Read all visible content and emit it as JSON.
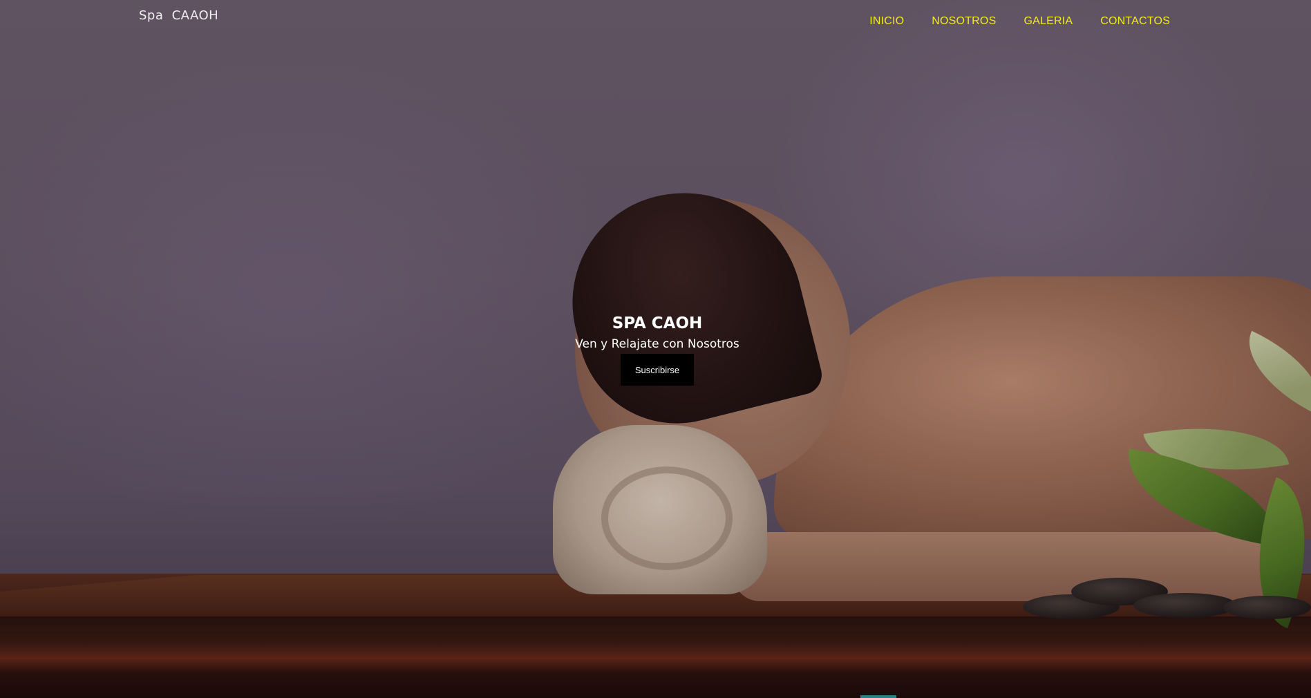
{
  "header": {
    "brand": "Spa  CAAOH",
    "nav": [
      {
        "label": "INICIO"
      },
      {
        "label": "NOSOTROS"
      },
      {
        "label": "GALERIA"
      },
      {
        "label": "CONTACTOS"
      }
    ]
  },
  "hero": {
    "title": "SPA CAOH",
    "subtitle": "Ven y Relajate con Nosotros",
    "button_label": "Suscribirse",
    "image_icon": "spa-massage-photo"
  },
  "colors": {
    "nav_link": "#f2ec1c",
    "button_bg": "#000000",
    "button_text": "#ffffff",
    "hero_text": "#ffffff",
    "background": "#6b5e6e"
  }
}
